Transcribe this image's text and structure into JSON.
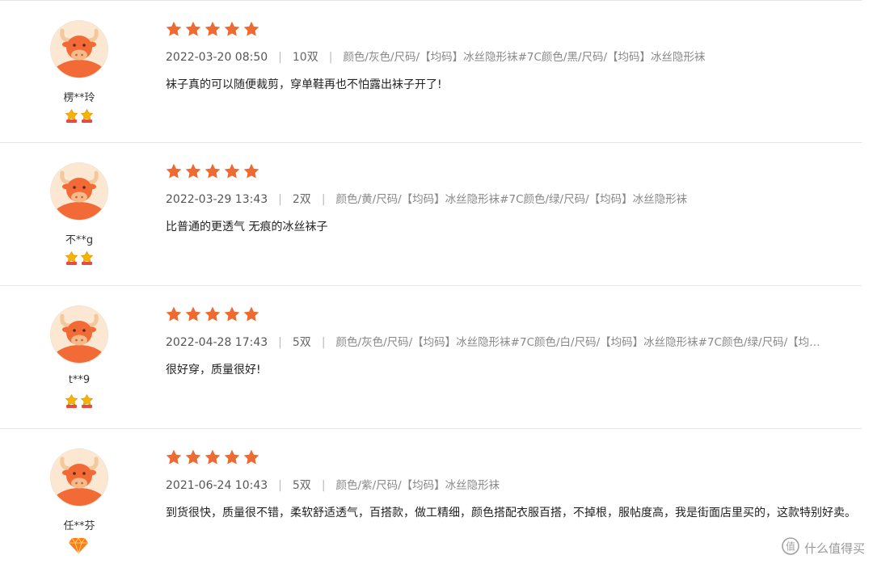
{
  "reviews": [
    {
      "nickname": "楞**玲",
      "level_icon": "double-crown-icon",
      "rating": 5,
      "date": "2022-03-20 08:50",
      "quantity": "10双",
      "spec": "颜色/灰色/尺码/【均码】冰丝隐形袜#7C颜色/黑/尺码/【均码】冰丝隐形袜",
      "content": "袜子真的可以随便裁剪，穿单鞋再也不怕露出袜子开了!"
    },
    {
      "nickname": "不**g",
      "level_icon": "double-crown-icon",
      "rating": 5,
      "date": "2022-03-29 13:43",
      "quantity": "2双",
      "spec": "颜色/黄/尺码/【均码】冰丝隐形袜#7C颜色/绿/尺码/【均码】冰丝隐形袜",
      "content": "比普通的更透气 无痕的冰丝袜子"
    },
    {
      "nickname": "t**9",
      "level_icon": "double-crown-icon",
      "rating": 5,
      "date": "2022-04-28 17:43",
      "quantity": "5双",
      "spec": "颜色/灰色/尺码/【均码】冰丝隐形袜#7C颜色/白/尺码/【均码】冰丝隐形袜#7C颜色/绿/尺码/【均…",
      "content": "很好穿，质量很好!"
    },
    {
      "nickname": "任**芬",
      "level_icon": "diamond-icon",
      "rating": 5,
      "date": "2021-06-24 10:43",
      "quantity": "5双",
      "spec": "颜色/紫/尺码/【均码】冰丝隐形袜",
      "content": "到货很快，质量很不错，柔软舒适透气，百搭款，做工精细，颜色搭配衣服百搭，不掉根，服帖度高，我是街面店里买的，这款特别好卖。"
    }
  ],
  "separator": "|",
  "watermark": {
    "text": "什么值得买",
    "icon": "zhi-logo-icon"
  },
  "colors": {
    "star": "#ee6a30",
    "avatar_bg": "#fce7d3",
    "avatar_body": "#f26a35",
    "divider": "#e6e6e6"
  }
}
